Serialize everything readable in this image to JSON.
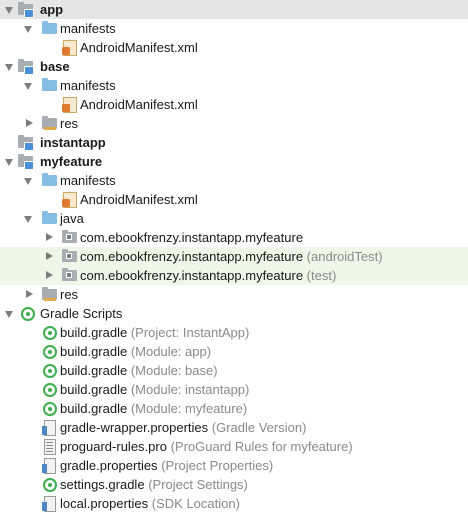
{
  "tree": {
    "app": {
      "label": "app"
    },
    "app_manifests": {
      "label": "manifests"
    },
    "app_manifest_file": {
      "label": "AndroidManifest.xml"
    },
    "base": {
      "label": "base"
    },
    "base_manifests": {
      "label": "manifests"
    },
    "base_manifest_file": {
      "label": "AndroidManifest.xml"
    },
    "base_res": {
      "label": "res"
    },
    "instantapp": {
      "label": "instantapp"
    },
    "myfeature": {
      "label": "myfeature"
    },
    "myfeature_manifests": {
      "label": "manifests"
    },
    "myfeature_manifest_file": {
      "label": "AndroidManifest.xml"
    },
    "myfeature_java": {
      "label": "java"
    },
    "pkg_main": {
      "label": "com.ebookfrenzy.instantapp.myfeature",
      "hint": ""
    },
    "pkg_android_test": {
      "label": "com.ebookfrenzy.instantapp.myfeature",
      "hint": "(androidTest)"
    },
    "pkg_test": {
      "label": "com.ebookfrenzy.instantapp.myfeature",
      "hint": "(test)"
    },
    "myfeature_res": {
      "label": "res"
    },
    "gradle_scripts": {
      "label": "Gradle Scripts"
    },
    "build_project": {
      "label": "build.gradle",
      "hint": "(Project: InstantApp)"
    },
    "build_app": {
      "label": "build.gradle",
      "hint": "(Module: app)"
    },
    "build_base": {
      "label": "build.gradle",
      "hint": "(Module: base)"
    },
    "build_instantapp": {
      "label": "build.gradle",
      "hint": "(Module: instantapp)"
    },
    "build_myfeature": {
      "label": "build.gradle",
      "hint": "(Module: myfeature)"
    },
    "gradle_wrapper": {
      "label": "gradle-wrapper.properties",
      "hint": "(Gradle Version)"
    },
    "proguard": {
      "label": "proguard-rules.pro",
      "hint": "(ProGuard Rules for myfeature)"
    },
    "gradle_properties": {
      "label": "gradle.properties",
      "hint": "(Project Properties)"
    },
    "settings_gradle": {
      "label": "settings.gradle",
      "hint": "(Project Settings)"
    },
    "local_properties": {
      "label": "local.properties",
      "hint": "(SDK Location)"
    }
  },
  "colors": {
    "selected_row": "#e5e5e5",
    "test_row": "#eef7e8",
    "folder_blue": "#86bde3",
    "gradle_green": "#3dae4d",
    "hint_grey": "#8a8a8a"
  }
}
